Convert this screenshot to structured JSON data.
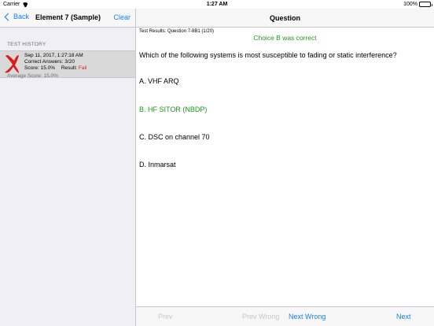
{
  "status_bar": {
    "carrier": "Carrier",
    "time": "1:27 AM",
    "battery_text": "100%",
    "battery_level": 1.0
  },
  "left": {
    "back_label": "Back",
    "title": "Element 7 (Sample)",
    "clear_label": "Clear",
    "section_header": "TEST HISTORY",
    "history": [
      {
        "date": "Sep 11, 2017, 1:27:18 AM",
        "correct_answers": "Correct Answers:   3/20",
        "score": "Score:  15.0%",
        "result_label": "Result:",
        "result_value": "Fail"
      }
    ],
    "average_score": "Average Score: 15.0%"
  },
  "right": {
    "title": "Question",
    "test_results": "Test Results:  Question 7-8B1 (1/20)",
    "feedback": "Choice B was correct",
    "question": "Which of the following systems is most susceptible to fading or static interference?",
    "choices": [
      "A. VHF ARQ",
      "B. HF SITOR (NBDP)",
      "C. DSC on channel 70",
      "D. Inmarsat"
    ],
    "toolbar": {
      "prev": "Prev",
      "prev_wrong": "Prev Wrong",
      "next_wrong": "Next Wrong",
      "next": "Next"
    }
  },
  "colors": {
    "accent": "#157efb",
    "correct": "#1e9a1e",
    "fail": "#e02020"
  }
}
